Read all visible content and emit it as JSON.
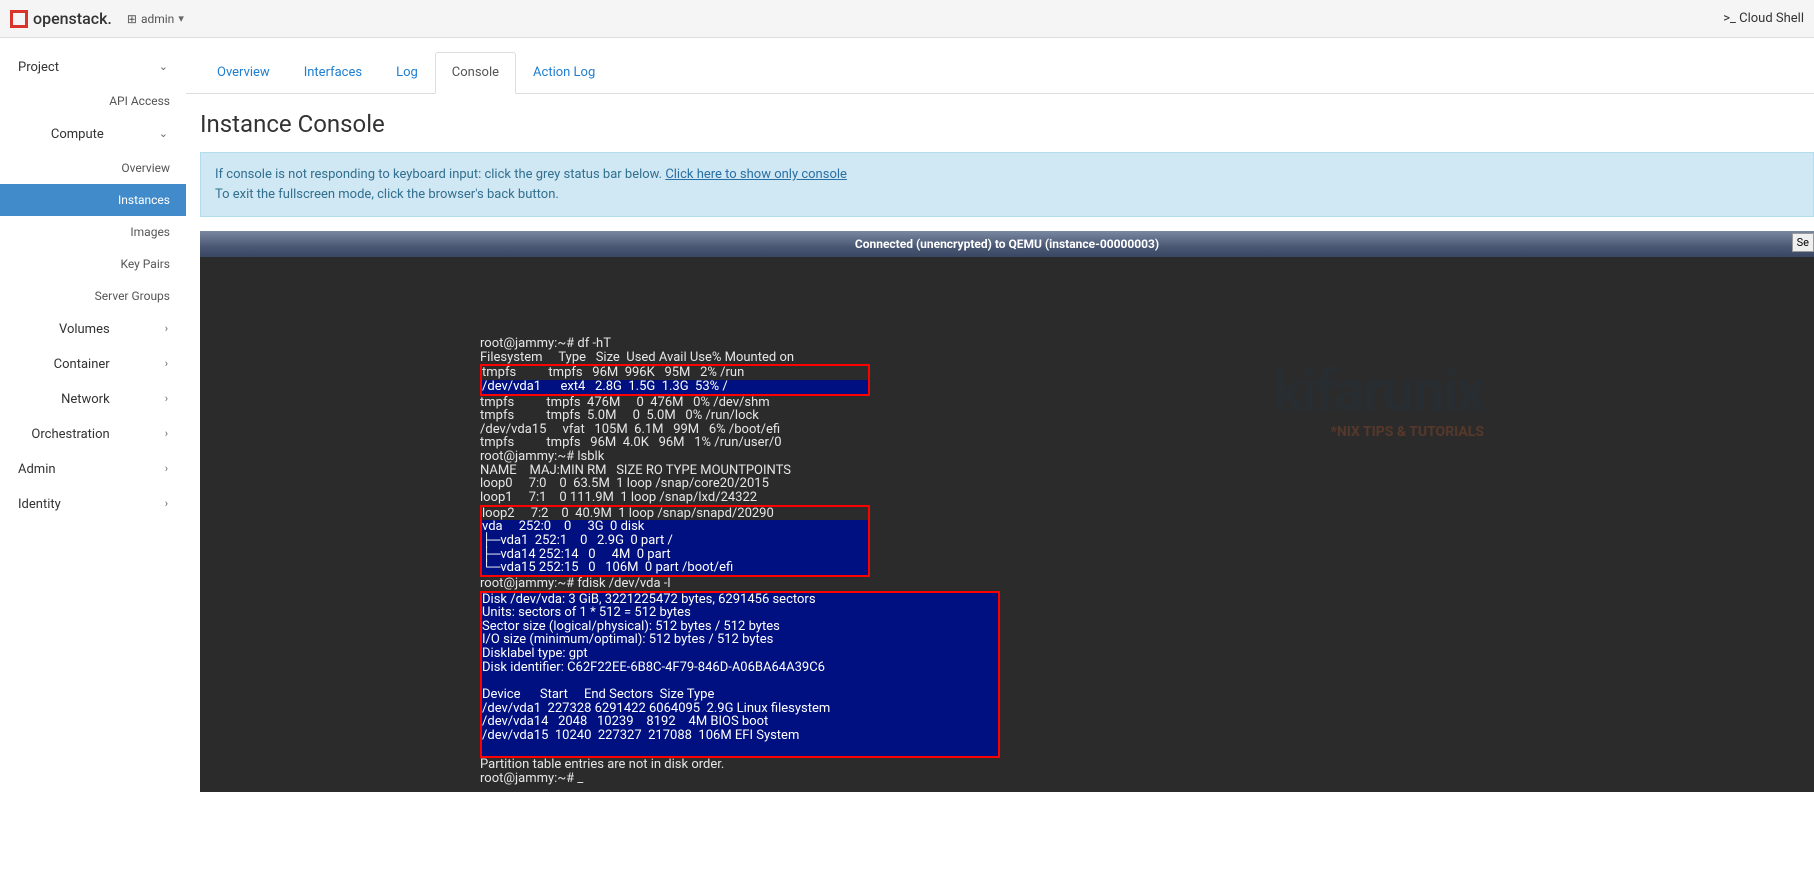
{
  "topbar": {
    "brand": "openstack.",
    "domain_icon": "⊞",
    "domain": "admin",
    "cloudshell": ">_ Cloud Shell"
  },
  "sidebar": {
    "project": "Project",
    "api": "API Access",
    "compute": "Compute",
    "compute_items": [
      "Overview",
      "Instances",
      "Images",
      "Key Pairs",
      "Server Groups"
    ],
    "volumes": "Volumes",
    "container": "Container",
    "network": "Network",
    "orch": "Orchestration",
    "admin": "Admin",
    "identity": "Identity"
  },
  "tabs": [
    "Overview",
    "Interfaces",
    "Log",
    "Console",
    "Action Log"
  ],
  "title": "Instance Console",
  "alert": {
    "l1a": "If console is not responding to keyboard input: click the grey status bar below. ",
    "link": "Click here to show only console",
    "l2": "To exit the fullscreen mode, click the browser's back button."
  },
  "console": {
    "bar": "Connected (unencrypted) to QEMU (instance-00000003)",
    "send": "Se",
    "watermark": "kifarunix",
    "watermark_sub": "*NIX TIPS & TUTORIALS",
    "l1": "root@jammy:~# df -hT",
    "l2": "Filesystem     Type   Size  Used Avail Use% Mounted on",
    "l3": "tmpfs          tmpfs   96M  996K   95M   2% /run",
    "l4": "/dev/vda1      ext4   2.8G  1.5G  1.3G  53% /",
    "l5": "tmpfs          tmpfs  476M     0  476M   0% /dev/shm",
    "l6": "tmpfs          tmpfs  5.0M     0  5.0M   0% /run/lock",
    "l7": "/dev/vda15     vfat   105M  6.1M   99M   6% /boot/efi",
    "l8": "tmpfs          tmpfs   96M  4.0K   96M   1% /run/user/0",
    "l9": "root@jammy:~# lsblk",
    "l10": "NAME    MAJ:MIN RM   SIZE RO TYPE MOUNTPOINTS",
    "l11": "loop0     7:0    0  63.5M  1 loop /snap/core20/2015",
    "l12": "loop1     7:1    0 111.9M  1 loop /snap/lxd/24322",
    "l13": "loop2     7:2    0  40.9M  1 loop /snap/snapd/20290",
    "l14": "vda     252:0    0     3G  0 disk ",
    "l15": "├─vda1  252:1    0   2.9G  0 part /",
    "l16": "├─vda14 252:14   0     4M  0 part ",
    "l17": "└─vda15 252:15   0   106M  0 part /boot/efi",
    "l18": "root@jammy:~# fdisk /dev/vda -l",
    "l19": "Disk /dev/vda: 3 GiB, 3221225472 bytes, 6291456 sectors",
    "l20": "Units: sectors of 1 * 512 = 512 bytes",
    "l21": "Sector size (logical/physical): 512 bytes / 512 bytes",
    "l22": "I/O size (minimum/optimal): 512 bytes / 512 bytes",
    "l23": "Disklabel type: gpt",
    "l24": "Disk identifier: C62F22EE-6B8C-4F79-846D-A06BA64A39C6",
    "l25": " ",
    "l26": "Device      Start     End Sectors  Size Type",
    "l27": "/dev/vda1  227328 6291422 6064095  2.9G Linux filesystem",
    "l28": "/dev/vda14   2048   10239    8192    4M BIOS boot",
    "l29": "/dev/vda15  10240  227327  217088  106M EFI System",
    "l30": " ",
    "l31": "Partition table entries are not in disk order.",
    "l32": "root@jammy:~# _"
  }
}
